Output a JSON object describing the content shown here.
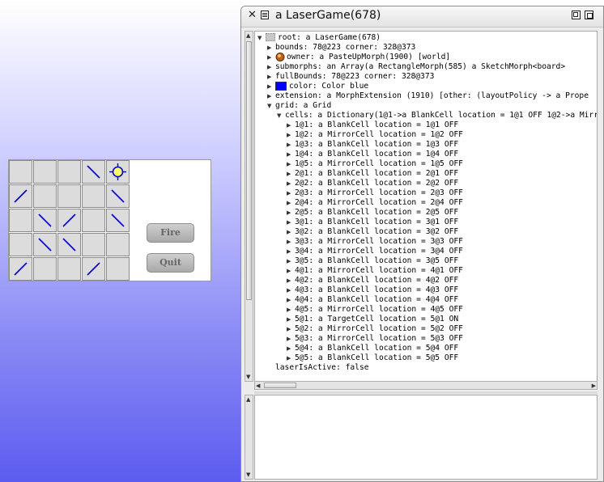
{
  "game": {
    "fire_label": "Fire",
    "quit_label": "Quit",
    "cells": [
      [
        "blank",
        "blank",
        "blank",
        "mirror-back",
        "target"
      ],
      [
        "mirror-fwd",
        "blank",
        "blank",
        "blank",
        "mirror-back"
      ],
      [
        "blank",
        "mirror-back",
        "mirror-fwd",
        "blank",
        "mirror-back"
      ],
      [
        "blank",
        "mirror-back",
        "mirror-back",
        "blank",
        "blank"
      ],
      [
        "mirror-fwd",
        "blank",
        "blank",
        "mirror-fwd",
        "blank"
      ]
    ],
    "colors": {
      "mirror": "#0000cc",
      "target": "#0000cc",
      "cell": "#dcdcdc"
    }
  },
  "window": {
    "title": "a LaserGame(678)",
    "close_icon": "close-icon",
    "menu_icon": "menu-icon",
    "collapse_icon": "collapse-icon",
    "expand_icon": "expand-icon"
  },
  "tree": {
    "rows": [
      {
        "text": "root: a LaserGame(678)",
        "indent": 0,
        "tri": "open",
        "icon": "root"
      },
      {
        "text": "bounds: 78@223 corner: 328@373",
        "indent": 1,
        "tri": "closed"
      },
      {
        "text": "owner: a PasteUpMorph(1900) [world]",
        "indent": 1,
        "tri": "closed",
        "icon": "owner"
      },
      {
        "text": "submorphs: an Array(a RectangleMorph(585) a SketchMorph<board>",
        "indent": 1,
        "tri": "closed"
      },
      {
        "text": "fullBounds: 78@223 corner: 328@373",
        "indent": 1,
        "tri": "closed"
      },
      {
        "text": "color: Color blue",
        "indent": 1,
        "tri": "closed",
        "icon": "swatch"
      },
      {
        "text": "extension: a MorphExtension (1910) [other:  (layoutPolicy -> a Prope",
        "indent": 1,
        "tri": "closed"
      },
      {
        "text": "grid: a Grid",
        "indent": 1,
        "tri": "open"
      },
      {
        "text": "cells: a Dictionary(1@1->a BlankCell location = 1@1 OFF 1@2->a Mirr",
        "indent": 2,
        "tri": "open"
      },
      {
        "text": "1@1: a BlankCell location = 1@1 OFF",
        "indent": 3,
        "tri": "closed"
      },
      {
        "text": "1@2: a MirrorCell location = 1@2 OFF",
        "indent": 3,
        "tri": "closed"
      },
      {
        "text": "1@3: a BlankCell location = 1@3 OFF",
        "indent": 3,
        "tri": "closed"
      },
      {
        "text": "1@4: a BlankCell location = 1@4 OFF",
        "indent": 3,
        "tri": "closed"
      },
      {
        "text": "1@5: a MirrorCell location = 1@5 OFF",
        "indent": 3,
        "tri": "closed"
      },
      {
        "text": "2@1: a BlankCell location = 2@1 OFF",
        "indent": 3,
        "tri": "closed"
      },
      {
        "text": "2@2: a BlankCell location = 2@2 OFF",
        "indent": 3,
        "tri": "closed"
      },
      {
        "text": "2@3: a MirrorCell location = 2@3 OFF",
        "indent": 3,
        "tri": "closed"
      },
      {
        "text": "2@4: a MirrorCell location = 2@4 OFF",
        "indent": 3,
        "tri": "closed"
      },
      {
        "text": "2@5: a BlankCell location = 2@5 OFF",
        "indent": 3,
        "tri": "closed"
      },
      {
        "text": "3@1: a BlankCell location = 3@1 OFF",
        "indent": 3,
        "tri": "closed"
      },
      {
        "text": "3@2: a BlankCell location = 3@2 OFF",
        "indent": 3,
        "tri": "closed"
      },
      {
        "text": "3@3: a MirrorCell location = 3@3 OFF",
        "indent": 3,
        "tri": "closed"
      },
      {
        "text": "3@4: a MirrorCell location = 3@4 OFF",
        "indent": 3,
        "tri": "closed"
      },
      {
        "text": "3@5: a BlankCell location = 3@5 OFF",
        "indent": 3,
        "tri": "closed"
      },
      {
        "text": "4@1: a MirrorCell location = 4@1 OFF",
        "indent": 3,
        "tri": "closed"
      },
      {
        "text": "4@2: a BlankCell location = 4@2 OFF",
        "indent": 3,
        "tri": "closed"
      },
      {
        "text": "4@3: a BlankCell location = 4@3 OFF",
        "indent": 3,
        "tri": "closed"
      },
      {
        "text": "4@4: a BlankCell location = 4@4 OFF",
        "indent": 3,
        "tri": "closed"
      },
      {
        "text": "4@5: a MirrorCell location = 4@5 OFF",
        "indent": 3,
        "tri": "closed"
      },
      {
        "text": "5@1: a TargetCell location = 5@1 ON",
        "indent": 3,
        "tri": "closed"
      },
      {
        "text": "5@2: a MirrorCell location = 5@2 OFF",
        "indent": 3,
        "tri": "closed"
      },
      {
        "text": "5@3: a MirrorCell location = 5@3 OFF",
        "indent": 3,
        "tri": "closed"
      },
      {
        "text": "5@4: a BlankCell location = 5@4 OFF",
        "indent": 3,
        "tri": "closed"
      },
      {
        "text": "5@5: a BlankCell location = 5@5 OFF",
        "indent": 3,
        "tri": "closed"
      },
      {
        "text": "laserIsActive: false",
        "indent": 1,
        "tri": "none"
      }
    ]
  },
  "code_pane": {
    "text": ""
  }
}
